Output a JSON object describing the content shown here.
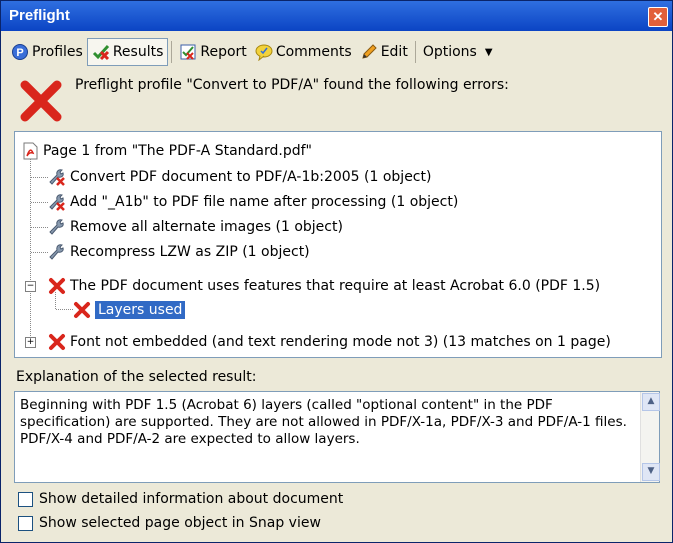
{
  "window": {
    "title": "Preflight",
    "close_glyph": "✕"
  },
  "toolbar": {
    "profiles": "Profiles",
    "results": "Results",
    "report": "Report",
    "comments": "Comments",
    "edit": "Edit",
    "options": "Options",
    "options_caret": "▼"
  },
  "header": {
    "message": "Preflight profile \"Convert to PDF/A\" found the following errors:"
  },
  "tree": {
    "page": "Page 1 from \"The PDF-A Standard.pdf\"",
    "items": [
      "Convert PDF document to PDF/A-1b:2005 (1 object)",
      "Add \"_A1b\" to PDF file name after processing (1 object)",
      "Remove all alternate images (1 object)",
      "Recompress LZW as ZIP  (1 object)",
      "The PDF document uses features that require at least Acrobat 6.0 (PDF 1.5)",
      "Layers used",
      "Font not embedded (and text rendering mode not 3) (13 matches on 1 page)"
    ],
    "minus": "−",
    "plus": "+"
  },
  "explanation": {
    "label": "Explanation of the selected result:",
    "text": "Beginning with PDF 1.5 (Acrobat 6) layers (called \"optional content\" in the PDF specification) are supported. They are not allowed in PDF/X-1a, PDF/X-3 and PDF/A-1 files. PDF/X-4 and PDF/A-2 are expected to allow layers.",
    "scroll_up": "▲",
    "scroll_down": "▼"
  },
  "options": {
    "detailed_info": "Show detailed information about document",
    "snap_view": "Show selected page object in Snap view"
  },
  "colors": {
    "title_bar": "#0b44c4",
    "error_red": "#d9261c",
    "selection": "#316ac5"
  }
}
